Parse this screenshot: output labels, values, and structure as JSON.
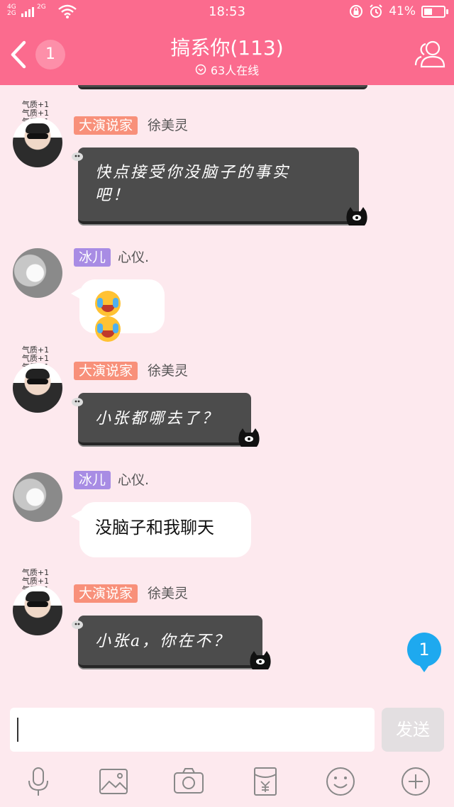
{
  "status_bar": {
    "network_top": "4G",
    "network_bottom": "2G",
    "network2": "2G",
    "time": "18:53",
    "battery": "41%",
    "battery_level": 0.41
  },
  "header": {
    "unread_count": "1",
    "title": "搞系你(113)",
    "online": "63人在线"
  },
  "messages": [
    {
      "badge": "大演说家",
      "name": "徐美灵",
      "avatar_tag": [
        "气质+1",
        "气质+1",
        "气质+1"
      ],
      "text_lines": [
        "快点接受你没脑子的事实",
        "吧！"
      ],
      "style": "dark"
    },
    {
      "badge": "冰儿",
      "name": "心仪.",
      "text": "😂😂",
      "style": "light"
    },
    {
      "badge": "大演说家",
      "name": "徐美灵",
      "avatar_tag": [
        "气质+1",
        "气质+1",
        "气质+1"
      ],
      "text": "小张都哪去了？",
      "style": "dark"
    },
    {
      "badge": "冰儿",
      "name": "心仪.",
      "text": "没脑子和我聊天",
      "style": "light"
    },
    {
      "badge": "大演说家",
      "name": "徐美灵",
      "avatar_tag": [
        "气质+1",
        "气质+1",
        "气质+1"
      ],
      "text": "小张a，你在不？",
      "style": "dark"
    }
  ],
  "floating_unread": "1",
  "input": {
    "placeholder": "",
    "send_label": "发送"
  },
  "toolbar": [
    "microphone-icon",
    "image-icon",
    "camera-icon",
    "red-packet-icon",
    "emoji-icon",
    "plus-icon"
  ],
  "colors": {
    "header": "#fb6b8e",
    "background": "#fde9ee",
    "badge_orange": "#f8907a",
    "badge_purple": "#a88ce4",
    "dark_bubble": "#4c4c4c",
    "unread_blue": "#1ea9ef"
  }
}
